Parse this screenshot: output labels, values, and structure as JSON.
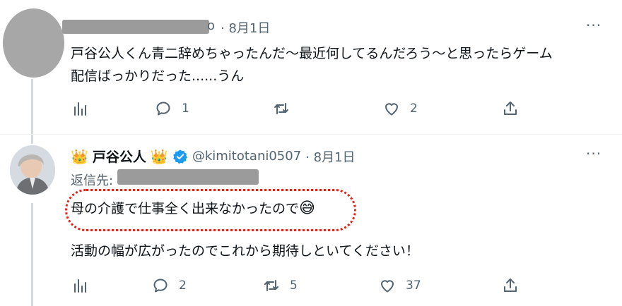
{
  "tweet1": {
    "name_suffix": "o",
    "date": "· 8月1日",
    "more": "···",
    "line1": "戸谷公人くん青二辞めちゃったんだ〜最近何してるんだろう〜と思ったらゲーム",
    "line2": "配信ばっかりだった......うん",
    "replies": "1",
    "retweets": "",
    "likes": "2"
  },
  "tweet2": {
    "name": "戸谷公人",
    "crown_left": "👑",
    "crown_right": "👑",
    "handle": "@kimitotani0507",
    "date": "· 8月1日",
    "more": "···",
    "reply_label": "返信先:",
    "line1": "母の介護で仕事全く出来なかったので",
    "emoji": "😅",
    "line2": "活動の幅が広がったのでこれから期待しといてください！",
    "replies": "2",
    "retweets": "5",
    "likes": "37"
  },
  "colors": {
    "meta": "#536471",
    "verified": "#1d9bf0",
    "highlight": "#e0261c",
    "redaction": "#9b9b9b"
  },
  "icons": [
    "analytics-icon",
    "reply-icon",
    "retweet-icon",
    "like-icon",
    "share-icon",
    "verified-badge-icon"
  ]
}
